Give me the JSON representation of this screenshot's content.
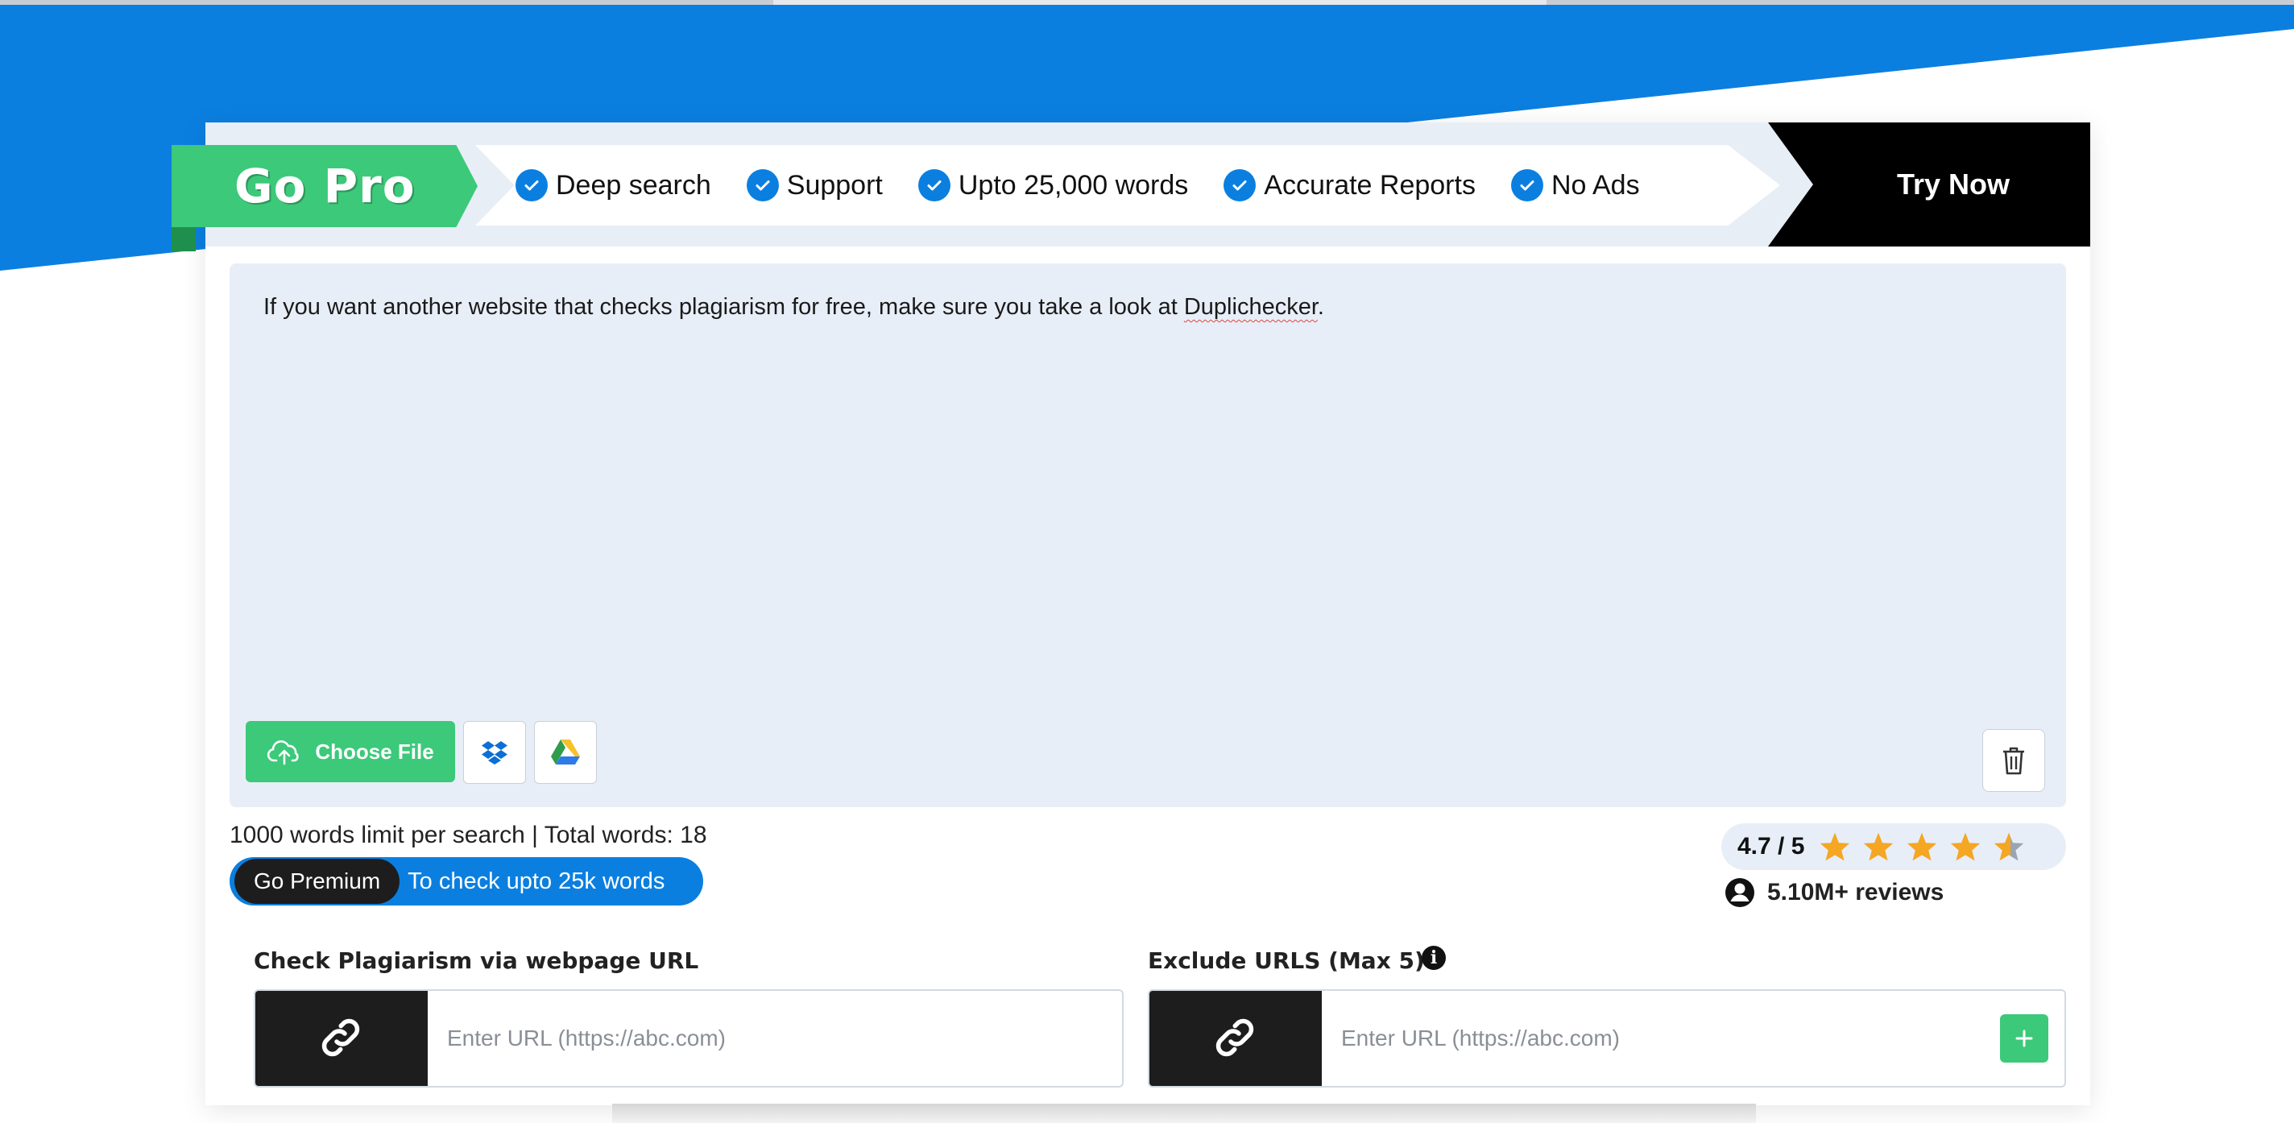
{
  "colors": {
    "accent_blue": "#0b7fe0",
    "accent_green": "#3cc97a",
    "dark": "#1d1d1d",
    "editor_bg": "#e8eef7",
    "star": "#f5a623"
  },
  "promo": {
    "badge": "Go Pro",
    "features": [
      "Deep search",
      "Support",
      "Upto 25,000 words",
      "Accurate Reports",
      "No Ads"
    ],
    "cta": "Try Now"
  },
  "editor": {
    "text_before": "If you want another website that checks plagiarism for free, make sure you take a look at ",
    "text_link": "Duplichecker",
    "text_after": ".",
    "choose_file": "Choose File",
    "icons": [
      "dropbox-icon",
      "google-drive-icon",
      "trash-icon"
    ]
  },
  "stats": {
    "limit_text": "1000 words limit per search | Total words: 18",
    "go_premium": "Go Premium",
    "premium_msg": "To check upto 25k words"
  },
  "rating": {
    "value": "4.7 / 5",
    "stars": 4.7,
    "reviews": "5.10M+ reviews"
  },
  "url_check": {
    "title": "Check Plagiarism via webpage URL",
    "placeholder": "Enter URL (https://abc.com)"
  },
  "exclude": {
    "title": "Exclude URLS (Max 5)",
    "placeholder": "Enter URL (https://abc.com)"
  }
}
